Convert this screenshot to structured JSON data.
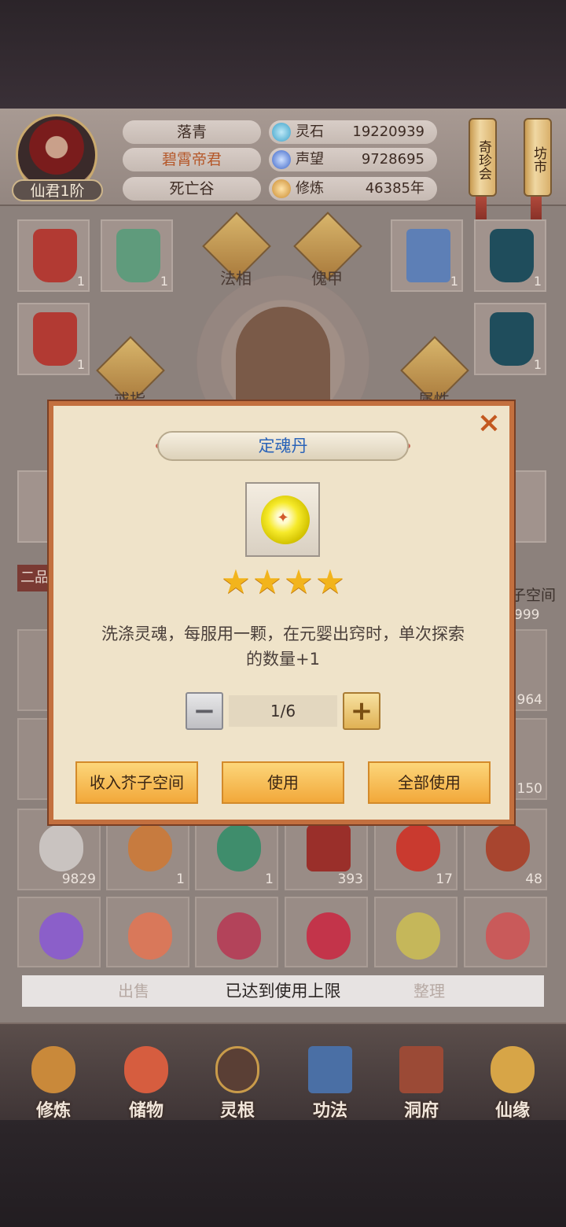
{
  "player": {
    "name": "落青",
    "title": "碧霄帝君",
    "location": "死亡谷",
    "rank": "仙君1阶"
  },
  "resources": [
    {
      "label": "灵石",
      "value": "19220939",
      "icon": "spirit-stone-icon"
    },
    {
      "label": "声望",
      "value": "9728695",
      "icon": "prestige-icon"
    },
    {
      "label": "修炼",
      "value": "46385年",
      "icon": "cultivation-icon"
    }
  ],
  "side_buttons": {
    "treasure_fair": "奇珍会",
    "market": "坊市"
  },
  "equipment": {
    "dharma_form": "法相",
    "puppet_armor": "傀甲",
    "ring": "戒指",
    "attribute": "属性",
    "slot_counts": [
      "1",
      "1",
      "1",
      "1",
      "1",
      "1"
    ]
  },
  "inventory": {
    "section_tag": "二品",
    "space_label": "子空间",
    "side_counts": [
      "999",
      "964",
      "150"
    ],
    "row_counts": [
      "9829",
      "1",
      "1",
      "393",
      "17",
      "48"
    ]
  },
  "action_bar": {
    "sell": "出售",
    "sort": "整理",
    "toast": "已达到使用上限"
  },
  "nav": [
    {
      "label": "修炼",
      "icon": "cultivation-nav-icon"
    },
    {
      "label": "储物",
      "icon": "storage-bag-icon"
    },
    {
      "label": "灵根",
      "icon": "spirit-root-icon"
    },
    {
      "label": "功法",
      "icon": "technique-book-icon"
    },
    {
      "label": "洞府",
      "icon": "cave-dwelling-icon"
    },
    {
      "label": "仙缘",
      "icon": "immortal-fate-icon"
    }
  ],
  "dialog": {
    "title": "定魂丹",
    "stars": 4,
    "description_line1": "洗涤灵魂，每服用一颗，在元婴出窍时，单次探索",
    "description_line2": "的数量+1",
    "quantity": "1/6",
    "close_symbol": "×",
    "minus_symbol": "−",
    "plus_symbol": "+",
    "star_symbol": "★",
    "buttons": {
      "store": "收入芥子空间",
      "use": "使用",
      "use_all": "全部使用"
    }
  },
  "colors": {
    "dialog_border": "#c3703f",
    "title_text": "#2a63b8",
    "button_fill": "#f2a83a",
    "star": "#f2b41c"
  }
}
